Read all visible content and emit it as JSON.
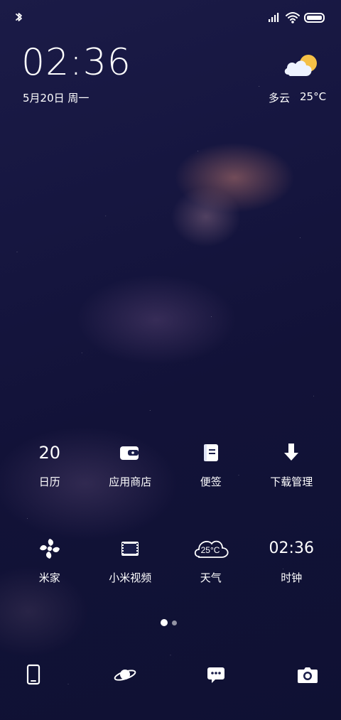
{
  "status_bar": {
    "bluetooth_icon": "bluetooth-icon",
    "signal_icon": "signal-icon",
    "wifi_icon": "wifi-icon",
    "battery_icon": "battery-icon"
  },
  "clock": {
    "time": "02:36",
    "date": "5月20日 周一"
  },
  "weather": {
    "condition": "多云",
    "temperature": "25°C"
  },
  "apps": [
    {
      "label": "日历",
      "icon": "calendar-icon",
      "value": "20"
    },
    {
      "label": "应用商店",
      "icon": "store-icon"
    },
    {
      "label": "便签",
      "icon": "notes-icon"
    },
    {
      "label": "下载管理",
      "icon": "download-icon"
    },
    {
      "label": "米家",
      "icon": "fan-icon"
    },
    {
      "label": "小米视频",
      "icon": "video-icon"
    },
    {
      "label": "天气",
      "icon": "weather-icon",
      "value": "25°C"
    },
    {
      "label": "时钟",
      "icon": "clock-icon",
      "value": "02:36"
    }
  ],
  "dock": [
    {
      "icon": "phone-icon"
    },
    {
      "icon": "planet-icon"
    },
    {
      "icon": "message-icon"
    },
    {
      "icon": "camera-icon"
    }
  ],
  "pager": {
    "active_page": 1,
    "page_count": 2
  },
  "colors": {
    "background": "#141440",
    "text": "#ffffff",
    "sun": "#f5c046"
  }
}
